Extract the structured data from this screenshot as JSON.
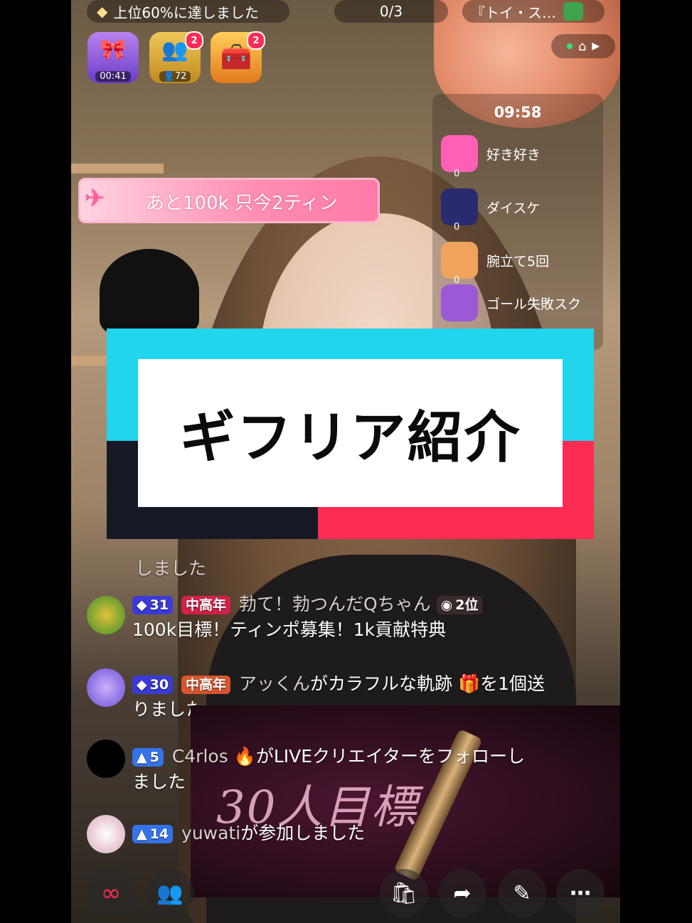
{
  "top": {
    "rank_text": "上位60%に達しました",
    "progress": "0/3",
    "title_text": "『トイ・ス…"
  },
  "badges": [
    {
      "name": "timer-box",
      "text": "00:41",
      "color": "#8b4cd6"
    },
    {
      "name": "fans",
      "text": "72",
      "count": "2",
      "color": "#d4a72a"
    },
    {
      "name": "treasure",
      "text": "",
      "count": "2",
      "color": "#e0852a"
    }
  ],
  "goal_bar": {
    "text": "あと100k 只今2ティン"
  },
  "gift_panel": {
    "time": "09:58",
    "items": [
      {
        "label": "好き好き",
        "count": "0",
        "color": "#ff5fb5"
      },
      {
        "label": "ダイスケ",
        "count": "0",
        "color": "#2a2a6e"
      },
      {
        "label": "腕立て5回",
        "count": "0",
        "color": "#f0a35a"
      },
      {
        "label": "ゴール失敗スク",
        "count": "",
        "color": "#9b59d6"
      }
    ]
  },
  "banner": {
    "title": "ギフリア紹介"
  },
  "chat": {
    "partial_line": "しました",
    "messages": [
      {
        "avatar_color": "#3c8f2c",
        "level": "31",
        "tag": "中高年",
        "user": "勃て！勃つんだQちゃん",
        "rank": "2位",
        "text": "100k目標！ティンポ募集！1k貢献特典"
      },
      {
        "avatar_color": "#6b4fd1",
        "level": "30",
        "tag": "中高年",
        "user": "アッくん",
        "text": "がカラフルな軌跡",
        "text2": "を1個送",
        "text3": "りました"
      },
      {
        "avatar_color": "#000000",
        "level": "5",
        "user": "C4rlos",
        "text": "がLIVEクリエイターをフォローし",
        "text2": "ました"
      },
      {
        "avatar_color": "#d9a7b7",
        "level": "14",
        "user": "yuwati",
        "text": "が参加しました"
      }
    ]
  },
  "overlay_goal": {
    "text": "30人目標"
  },
  "bottom_bar": {
    "buttons": [
      "link-icon",
      "people-icon",
      "shop-icon",
      "share-icon",
      "magic-wand-icon",
      "more-icon"
    ]
  }
}
